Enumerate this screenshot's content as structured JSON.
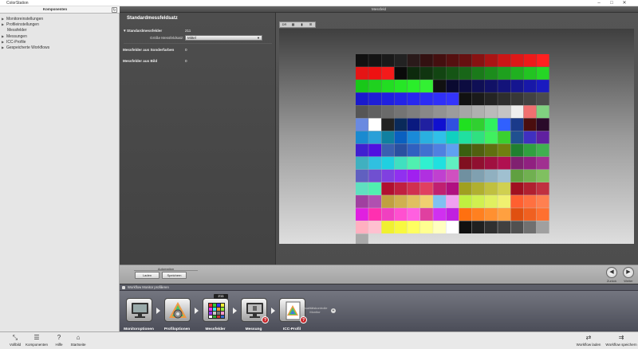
{
  "window": {
    "title": "ColorStation",
    "minimize": "–",
    "maximize": "□",
    "close": "✕"
  },
  "sidebar": {
    "title": "Komponenten",
    "refresh_icon": "refresh-icon",
    "items": [
      {
        "label": "Monitoreinstellungen",
        "child": false
      },
      {
        "label": "Profileinstellungen",
        "child": false
      },
      {
        "label": "Messfelder",
        "child": true
      },
      {
        "label": "Messungen",
        "child": false
      },
      {
        "label": "ICC-Profile",
        "child": false
      },
      {
        "label": "Gespeicherte Workflows",
        "child": false
      }
    ]
  },
  "main": {
    "title": "Messfeld"
  },
  "settings": {
    "title": "Standardmessfeldsatz",
    "standard_label": "Standardmessfelder",
    "standard_value": "211",
    "size_label": "Größe Messfeldsatz:",
    "size_value": "Mittel",
    "special_label": "Messfelder aus Sonderfarben",
    "special_value": "0",
    "image_label": "Messfelder aus Bild",
    "image_value": "0"
  },
  "view_toolbar": [
    "DR",
    "▦",
    "▮",
    "⊞"
  ],
  "bottom": {
    "automation_label": "Automation",
    "load_label": "Laden",
    "save_label": "Speichern",
    "back_label": "Zurück",
    "next_label": "Weiter"
  },
  "workflow": {
    "title": "Workflow Monitor profilieren",
    "count": "211",
    "steps": [
      {
        "label": "Monitoroptionen",
        "icon": "monitor-settings-icon",
        "badge": ""
      },
      {
        "label": "Profiloptionen",
        "icon": "profile-gear-icon",
        "badge": ""
      },
      {
        "label": "Messfelder",
        "icon": "patch-grid-icon",
        "badge": ""
      },
      {
        "label": "Messung",
        "icon": "measurement-monitor-icon",
        "badge": "?"
      },
      {
        "label": "ICC-Profil",
        "icon": "icc-profile-icon",
        "badge": "?"
      }
    ],
    "extra_step": "Qualitätskontrolle Monitor"
  },
  "statusbar": {
    "items": [
      {
        "label": "Vollbild",
        "icon": "fullscreen-icon"
      },
      {
        "label": "Komponenten",
        "icon": "components-list-icon"
      },
      {
        "label": "Hilfe",
        "icon": "help-icon"
      },
      {
        "label": "Startseite",
        "icon": "home-icon"
      }
    ],
    "right_items": [
      {
        "label": "Workflow laden",
        "icon": "workflow-load-icon"
      },
      {
        "label": "Workflow speichern",
        "icon": "workflow-save-icon"
      }
    ]
  },
  "colors": {
    "accent_red": "#c8282c",
    "stage_dark": "#4d4d4d"
  }
}
